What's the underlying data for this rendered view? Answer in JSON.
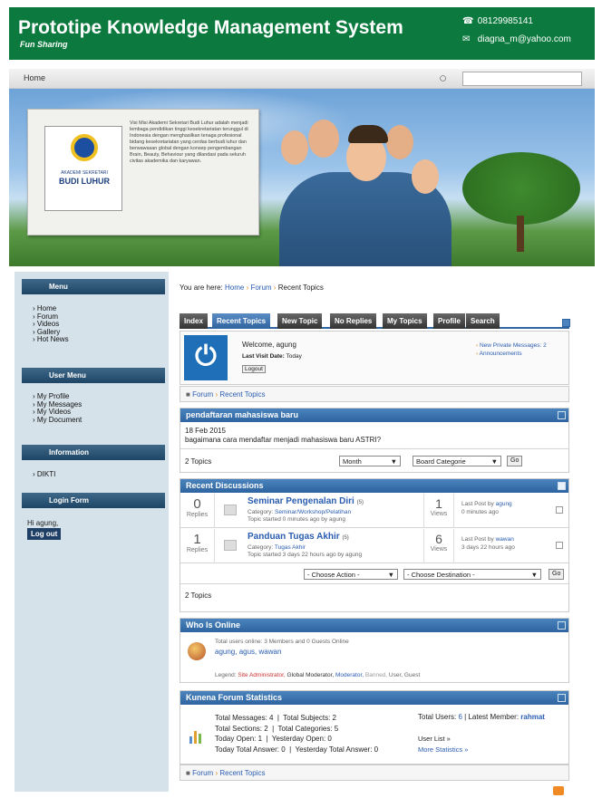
{
  "header": {
    "title": "Prototipe Knowledge Management System",
    "tagline": "Fun Sharing",
    "phone": "08129985141",
    "email": "diagna_m@yahoo.com",
    "phone_icon": "phone-icon",
    "email_icon": "mail-icon",
    "bg": "#0c7a3e"
  },
  "nav": {
    "home": "Home"
  },
  "banner": {
    "logo_small": "AKADEMI SEKRETARI",
    "logo_text": "BUDI LUHUR",
    "info_text": "Visi Misi Akademi Sekretari Budi Luhur adalah menjadi lembaga pendidikan tinggi kesekretariatan terunggul di Indonesia dengan menghasilkan tenaga profesional bidang kesekretariatan yang cerdas berbudi luhur dan berwawasan global dengan konsep pengembangan Brain, Beauty, Behaviour yang dilandasi pada seluruh civitas akademika dan karyawan."
  },
  "sidebar": {
    "menu_title": "Menu",
    "menu_items": [
      "Home",
      "Forum",
      "Videos",
      "Gallery",
      "Hot News"
    ],
    "user_title": "User Menu",
    "user_items": [
      "My Profile",
      "My Messages",
      "My Videos",
      "My Document"
    ],
    "info_title": "Information",
    "info_items": [
      "DIKTI"
    ],
    "login_title": "Login Form",
    "greeting": "Hi agung,",
    "logout": "Log out"
  },
  "breadcrumb": {
    "prefix": "You are here:",
    "items": [
      "Home",
      "Forum",
      "Recent Topics"
    ]
  },
  "tabs": [
    "Index",
    "Recent Topics",
    "New Topic",
    "No Replies",
    "My Topics",
    "Profile",
    "Search"
  ],
  "welcome": {
    "text": "Welcome, agung",
    "last_visit_label": "Last Visit Date:",
    "last_visit": "Today",
    "logout": "Logout",
    "pm": "New Private Messages: 2",
    "announcements": "Announcements"
  },
  "path": {
    "items": [
      "Forum",
      "Recent Topics"
    ]
  },
  "announcement": {
    "title": "pendaftaran mahasiswa baru",
    "date": "18 Feb 2015",
    "body": "bagaimana cara mendaftar menjadi mahasiswa baru ASTRI?",
    "topics": "2 Topics",
    "period": "Month",
    "category": "Board Categorie",
    "go": "Go"
  },
  "recent": {
    "title": "Recent Discussions",
    "topics": [
      {
        "replies": "0",
        "replies_label": "Replies",
        "title": "Seminar Pengenalan Diri",
        "new": "(5)",
        "category_label": "Category:",
        "category": "Seminar/Workshop/Pelatihan",
        "started": "Topic started 0 minutes ago by agung",
        "views": "1",
        "views_label": "Views",
        "last_post_label": "Last Post by",
        "last_post_by": "agung",
        "last_post_time": "0 minutes ago"
      },
      {
        "replies": "1",
        "replies_label": "Replies",
        "title": "Panduan Tugas Akhir",
        "new": "(5)",
        "category_label": "Category:",
        "category": "Tugas Akhir",
        "started": "Topic started 3 days 22 hours ago by agung",
        "views": "6",
        "views_label": "Views",
        "last_post_label": "Last Post by",
        "last_post_by": "wawan",
        "last_post_time": "3 days 22 hours ago"
      }
    ],
    "action": "- Choose Action -",
    "destination": "- Choose Destination -",
    "go": "Go",
    "count": "2 Topics"
  },
  "online": {
    "title": "Who Is Online",
    "summary": "Total users online: 3 Members and 0 Guests Online",
    "users": "agung, agus, wawan",
    "legend_label": "Legend:",
    "legend": [
      "Site Administrator,",
      "Global Moderator,",
      "Moderator,",
      "Banned,",
      "User,",
      "Guest"
    ],
    "legend_colors": [
      "#cc3333",
      "#333",
      "#2a5db0",
      "#999",
      "#666",
      "#666"
    ]
  },
  "stats": {
    "title": "Kunena Forum Statistics",
    "l1": "Total Messages: 4  |  Total Subjects: 2",
    "l2": "Total Sections: 2  |  Total Categories: 5",
    "l3": "Today Open: 1  |  Yesterday Open: 0",
    "l4": "Today Total Answer: 0  |  Yesterday Total Answer: 0",
    "users_label": "Total Users:",
    "users": "6",
    "latest_label": "| Latest Member:",
    "latest": "rahmat",
    "user_list": "User List »",
    "more": "More Statistics »"
  },
  "bottom_path": {
    "items": [
      "Forum",
      "Recent Topics"
    ]
  }
}
